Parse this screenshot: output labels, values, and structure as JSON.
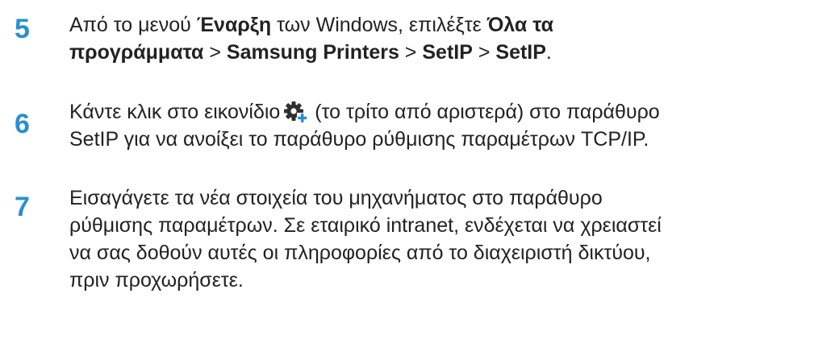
{
  "accent_color": "#2a8fd2",
  "steps": [
    {
      "number": "5",
      "t1": "Από το μενού ",
      "b1": "Έναρξη",
      "t2": " των Windows, επιλέξτε ",
      "b2": "Όλα τα",
      "b3": "προγράμματα",
      "sep1": " > ",
      "b4": "Samsung Printers",
      "sep2": " > ",
      "b5": "SetIP",
      "sep3": " > ",
      "b6": "SetIP",
      "end": "."
    },
    {
      "number": "6",
      "t1": "Κάντε κλικ στο εικονίδιο",
      "icon": "settings-add-icon",
      "t2": " (το τρίτο από αριστερά) στο παράθυρο",
      "t3": "SetIP για να ανοίξει το παράθυρο ρύθμισης παραμέτρων TCP/IP."
    },
    {
      "number": "7",
      "l1": "Εισαγάγετε τα νέα στοιχεία του μηχανήματος στο παράθυρο",
      "l2": "ρύθμισης παραμέτρων. Σε εταιρικό intranet, ενδέχεται να χρειαστεί",
      "l3": "να σας δοθούν αυτές οι πληροφορίες από το διαχειριστή δικτύου,",
      "l4": "πριν προχωρήσετε."
    }
  ]
}
